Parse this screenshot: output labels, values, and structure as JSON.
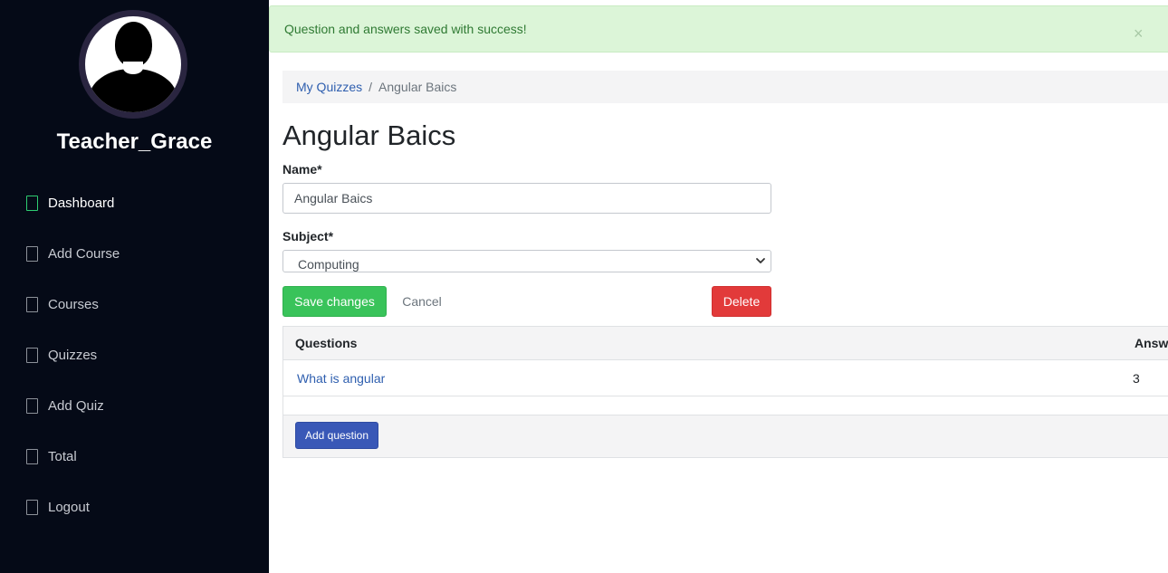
{
  "user": {
    "name": "Teacher_Grace"
  },
  "sidebar": {
    "items": [
      {
        "label": "Dashboard",
        "active": true
      },
      {
        "label": "Add Course"
      },
      {
        "label": "Courses"
      },
      {
        "label": "Quizzes"
      },
      {
        "label": "Add Quiz"
      },
      {
        "label": "Total"
      },
      {
        "label": "Logout"
      }
    ]
  },
  "alert": {
    "message": "Question and answers saved with success!",
    "close": "×"
  },
  "breadcrumb": {
    "parent": "My Quizzes",
    "separator": "/",
    "current": "Angular Baics"
  },
  "page": {
    "title": "Angular Baics"
  },
  "form": {
    "name_label": "Name*",
    "name_value": "Angular Baics",
    "subject_label": "Subject*",
    "subject_value": "Computing",
    "save_label": "Save changes",
    "cancel_label": "Cancel",
    "delete_label": "Delete"
  },
  "table": {
    "headers": [
      "Questions",
      "Answ"
    ],
    "rows": [
      {
        "question": "What is angular",
        "answers": "3"
      }
    ],
    "add_label": "Add question"
  },
  "colors": {
    "sidebar_bg": "#050a17",
    "alert_bg": "#dcf5d8",
    "save": "#39c35a",
    "delete": "#e23a3a",
    "primary": "#3958b7",
    "link": "#2f5faf"
  }
}
